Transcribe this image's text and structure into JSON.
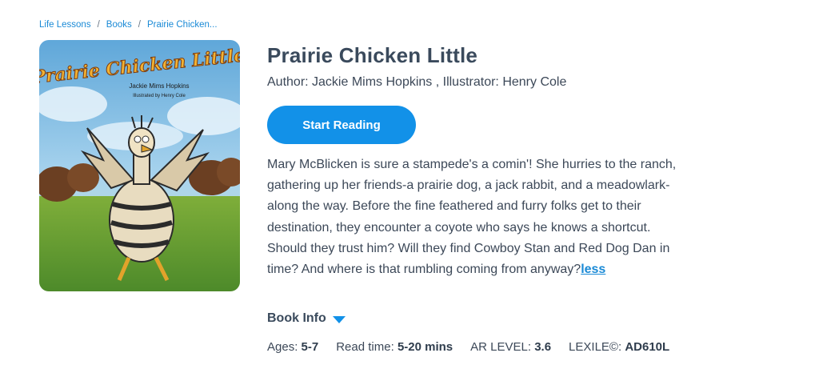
{
  "breadcrumb": {
    "items": [
      "Life Lessons",
      "Books",
      "Prairie Chicken..."
    ],
    "separator": "/"
  },
  "cover": {
    "title_text": "Prairie Chicken Little",
    "author_text": "Jackie Mims Hopkins",
    "illustrator_text": "Illustrated by Henry Cole"
  },
  "book": {
    "title": "Prairie Chicken Little",
    "author_line": "Author: Jackie Mims Hopkins , Illustrator: Henry Cole",
    "start_label": "Start Reading",
    "description": "Mary McBlicken is sure a stampede's a comin'! She hurries to the ranch, gathering up her friends-a prairie dog, a jack rabbit, and a meadowlark-along the way. Before the fine feathered and furry folks get to their destination, they encounter a coyote who says he knows a shortcut. Should they trust him? Will they find Cowboy Stan and Red Dog Dan in time? And where is that rumbling coming from anyway?",
    "less_label": "less",
    "info_label": "Book Info"
  },
  "meta": {
    "ages_label": "Ages:",
    "ages_value": "5-7",
    "readtime_label": "Read time:",
    "readtime_value": "5-20 mins",
    "ar_label": "AR LEVEL:",
    "ar_value": "3.6",
    "lexile_label": "LEXILE©:",
    "lexile_value": "AD610L"
  },
  "colors": {
    "accent": "#1291e8",
    "link": "#1a8ad6",
    "text": "#3c4858"
  }
}
